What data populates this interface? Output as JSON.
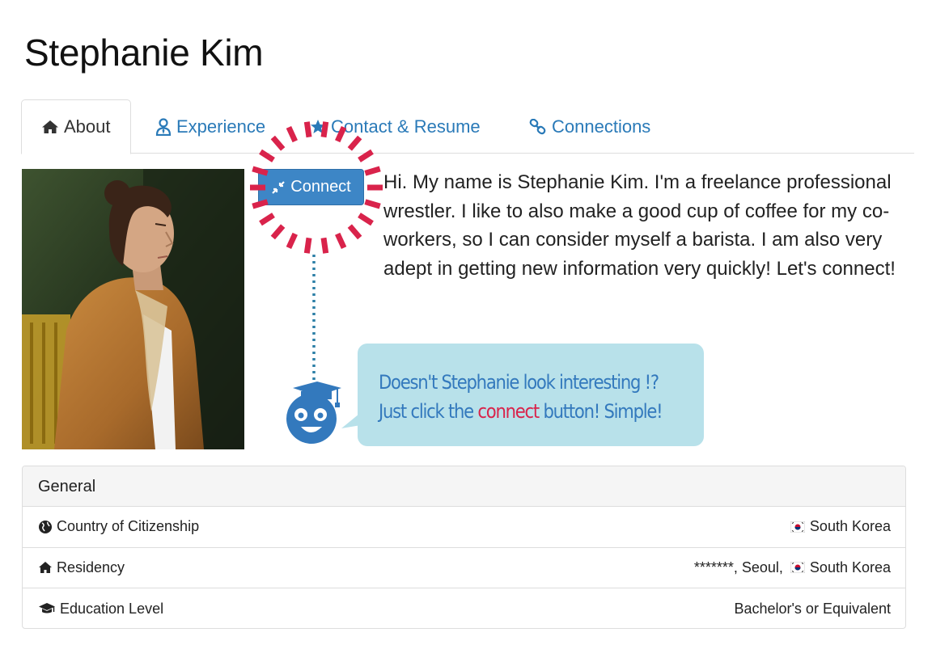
{
  "profile": {
    "name": "Stephanie Kim"
  },
  "tabs": [
    {
      "label": "About",
      "icon": "home-icon",
      "active": true
    },
    {
      "label": "Experience",
      "icon": "user-tie-icon",
      "active": false
    },
    {
      "label": "Contact & Resume",
      "icon": "star-icon",
      "active": false
    },
    {
      "label": "Connections",
      "icon": "link-icon",
      "active": false
    }
  ],
  "connect_button": {
    "label": "Connect",
    "icon": "compress-arrows-icon"
  },
  "bio": "Hi. My name is Stephanie Kim. I'm a freelance professional wrestler. I like to also make a good cup of coffee for my co-workers, so I can consider myself a barista. I am also very adept in getting new information very quickly! Let's connect!",
  "tip": {
    "line1": "Doesn't Stephanie look interesting !?",
    "line2_before": "Just click the ",
    "line2_highlight": "connect",
    "line2_after": " button! Simple!",
    "mascot_icon": "graduate-mascot-icon"
  },
  "general": {
    "heading": "General",
    "rows": [
      {
        "label": "Country of Citizenship",
        "icon": "globe-icon",
        "flag_icon": "south-korea-flag-icon",
        "value": "South Korea"
      },
      {
        "label": "Residency",
        "icon": "home-icon",
        "value_prefix": "*******, Seoul, ",
        "flag_icon": "south-korea-flag-icon",
        "value": "South Korea"
      },
      {
        "label": "Education Level",
        "icon": "graduation-cap-icon",
        "value": "Bachelor's or Equivalent"
      }
    ]
  },
  "colors": {
    "link": "#2a7ab8",
    "button": "#3d86c6",
    "burst": "#d9234b",
    "tip_bg": "#b8e1ea",
    "tip_text": "#3379bd",
    "mascot": "#3379bd"
  }
}
